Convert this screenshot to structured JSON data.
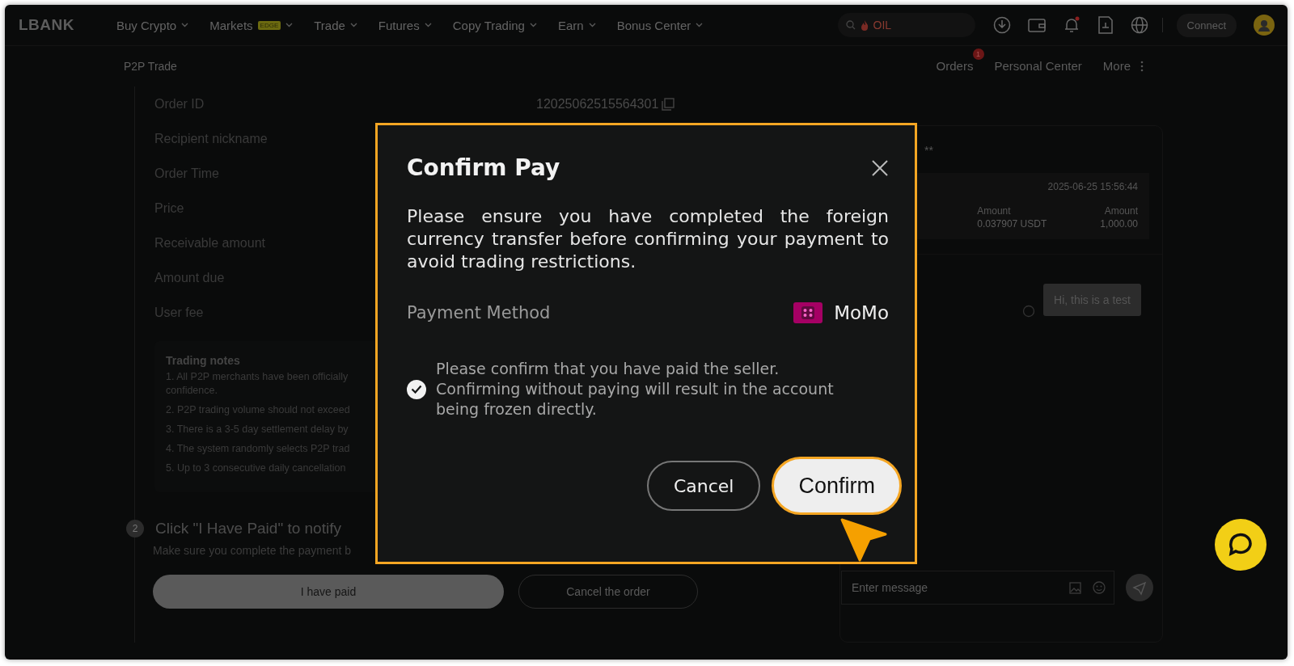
{
  "nav": {
    "logo": "LBANK",
    "menu": [
      {
        "label": "Buy Crypto"
      },
      {
        "label": "Markets",
        "badge": "EDGE"
      },
      {
        "label": "Trade"
      },
      {
        "label": "Futures"
      },
      {
        "label": "Copy Trading"
      },
      {
        "label": "Earn"
      },
      {
        "label": "Bonus Center"
      }
    ],
    "search": {
      "placeholder": "OIL"
    },
    "connect": "Connect"
  },
  "subnav": {
    "title": "P2P Trade",
    "links": [
      {
        "label": "Orders",
        "badge": "1"
      },
      {
        "label": "Personal Center"
      },
      {
        "label": "More"
      }
    ]
  },
  "order": {
    "fields": [
      {
        "label": "Order ID",
        "value": "12025062515564301"
      },
      {
        "label": "Recipient nickname"
      },
      {
        "label": "Order Time"
      },
      {
        "label": "Price"
      },
      {
        "label": "Receivable amount"
      },
      {
        "label": "Amount due"
      },
      {
        "label": "User fee"
      }
    ],
    "notes": {
      "title": "Trading notes",
      "items": [
        [
          "1. All P2P merchants have been officially",
          "confidence."
        ],
        [
          "2. P2P trading volume should not exceed"
        ],
        [
          "3. There is a 3-5 day settlement delay by"
        ],
        [
          "4. The system randomly selects P2P trad"
        ],
        [
          "5. Up to 3 consecutive daily cancellation"
        ]
      ]
    },
    "step": {
      "number": "2",
      "title": "Click \"I Have Paid\" to notify",
      "text": "Make sure you complete the payment b"
    },
    "buttons": [
      {
        "label": "I have paid",
        "kind": "primary"
      },
      {
        "label": "Cancel the order",
        "kind": "outline"
      }
    ]
  },
  "chat": {
    "header_fragment": "**",
    "card": {
      "time": "2025-06-25 15:56:44",
      "columns": [
        {
          "label": "Amount",
          "value": "0.037907 USDT"
        },
        {
          "label": "Amount",
          "value": "1,000.00"
        }
      ]
    },
    "messages": [
      {
        "text": "Hi, this is a test"
      }
    ],
    "input": {
      "placeholder": "Enter message"
    }
  },
  "modal": {
    "title": "Confirm Pay",
    "message": "Please ensure you have completed the foreign currency transfer before confirming your payment to avoid trading restrictions.",
    "payment_method": {
      "label": "Payment Method",
      "name": "MoMo"
    },
    "agreement": {
      "checked": true,
      "text": "Please confirm that you have paid the seller. Confirming without paying will result in the account being frozen directly."
    },
    "buttons": [
      {
        "label": "Cancel",
        "kind": "secondary",
        "highlighted": false
      },
      {
        "label": "Confirm",
        "kind": "primary",
        "highlighted": true
      }
    ]
  }
}
